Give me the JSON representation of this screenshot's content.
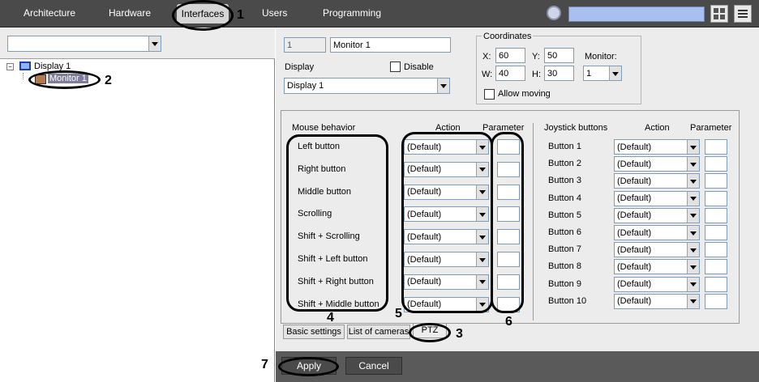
{
  "top_tabs": [
    "Architecture",
    "Hardware",
    "Interfaces",
    "Users",
    "Programming"
  ],
  "active_tab": "Interfaces",
  "tree": {
    "display": "Display 1",
    "monitor": "Monitor 1"
  },
  "object": {
    "id": "1",
    "name": "Monitor 1",
    "display_label": "Display",
    "disable_label": "Disable",
    "display_value": "Display 1"
  },
  "coordinates": {
    "title": "Coordinates",
    "x_label": "X:",
    "x": "60",
    "y_label": "Y:",
    "y": "50",
    "w_label": "W:",
    "w": "40",
    "h_label": "H:",
    "h": "30",
    "monitor_label": "Monitor:",
    "monitor_value": "1",
    "allow_moving": "Allow moving"
  },
  "mouse": {
    "header": "Mouse behavior",
    "action_header": "Action",
    "param_header": "Parameter",
    "rows": [
      "Left button",
      "Right button",
      "Middle button",
      "Scrolling",
      "Shift + Scrolling",
      "Shift + Left button",
      "Shift + Right button",
      "Shift + Middle button"
    ],
    "default_value": "(Default)"
  },
  "joystick": {
    "header": "Joystick buttons",
    "action_header": "Action",
    "param_header": "Parameter",
    "rows": [
      "Button 1",
      "Button 2",
      "Button 3",
      "Button 4",
      "Button 5",
      "Button 6",
      "Button 7",
      "Button 8",
      "Button 9",
      "Button 10"
    ],
    "default_value": "(Default)"
  },
  "bottom_tabs": [
    "Basic settings",
    "List of cameras",
    "PTZ"
  ],
  "buttons": {
    "apply": "Apply",
    "cancel": "Cancel"
  },
  "callouts": [
    "1",
    "2",
    "3",
    "4",
    "5",
    "6",
    "7"
  ]
}
